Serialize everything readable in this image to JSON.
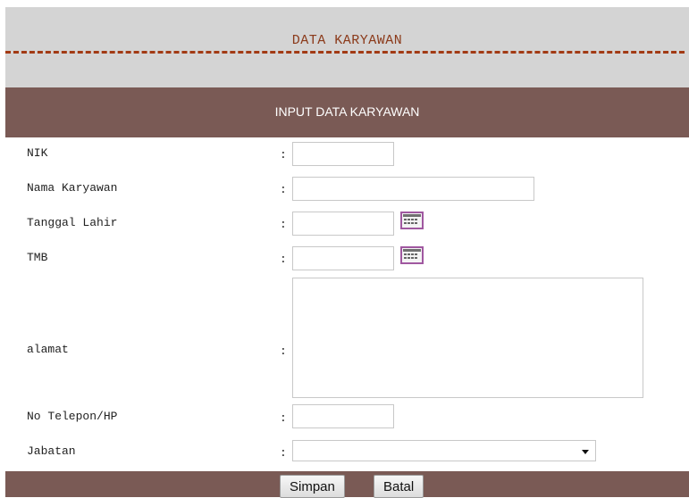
{
  "header": {
    "title": "DATA KARYAWAN"
  },
  "section": {
    "title": "INPUT DATA KARYAWAN"
  },
  "form": {
    "separator": ":",
    "fields": {
      "nik": {
        "label": "NIK",
        "value": ""
      },
      "nama": {
        "label": "Nama Karyawan",
        "value": ""
      },
      "tanggal_lahir": {
        "label": "Tanggal Lahir",
        "value": ""
      },
      "tmb": {
        "label": "TMB",
        "value": ""
      },
      "alamat": {
        "label": "alamat",
        "value": ""
      },
      "telepon": {
        "label": "No Telepon/HP",
        "value": ""
      },
      "jabatan": {
        "label": "Jabatan",
        "selected": ""
      }
    }
  },
  "buttons": {
    "simpan": "Simpan",
    "batal": "Batal"
  },
  "colors": {
    "header_bg": "#d4d4d4",
    "title_color": "#8b3a1a",
    "bar_bg": "#7a5a55",
    "dash": "#a23a14"
  }
}
